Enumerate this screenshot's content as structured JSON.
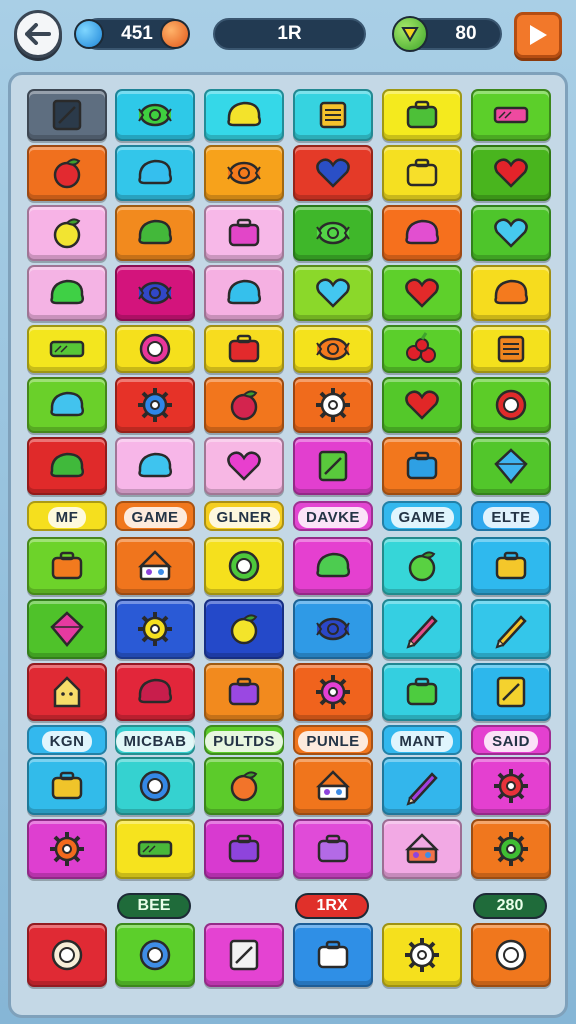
{
  "header": {
    "gems": "451",
    "level": "1R",
    "bonus": "80"
  },
  "board": {
    "rows": [
      [
        {
          "color": "#5e6e80",
          "icon": "frame-icon",
          "glyph": "frame",
          "fg": "#2b3a4a"
        },
        {
          "color": "#2ec9e8",
          "icon": "green-candy-icon",
          "glyph": "candy",
          "fg": "#3fcf3f"
        },
        {
          "color": "#35d8e8",
          "icon": "lemon-icon",
          "glyph": "blob",
          "fg": "#f3e32b"
        },
        {
          "color": "#36d3e0",
          "icon": "notepad-icon",
          "glyph": "note",
          "fg": "#f5c22c"
        },
        {
          "color": "#f4ea1e",
          "icon": "lunchbox-icon",
          "glyph": "box",
          "fg": "#4dc038"
        },
        {
          "color": "#5ccf2a",
          "icon": "pink-bar-icon",
          "glyph": "bar",
          "fg": "#ef4aa0"
        }
      ],
      [
        {
          "color": "#f0701e",
          "icon": "tomato-icon",
          "glyph": "fruit",
          "fg": "#e22a30"
        },
        {
          "color": "#33c6ea",
          "icon": "blue-bun-icon",
          "glyph": "blob",
          "fg": "#35bfee"
        },
        {
          "color": "#f7a21b",
          "icon": "orange-candy-icon",
          "glyph": "candy",
          "fg": "#f57a1c"
        },
        {
          "color": "#e43a28",
          "icon": "blue-heart-icon",
          "glyph": "heart",
          "fg": "#2a4fc6"
        },
        {
          "color": "#f5e021",
          "icon": "yellow-case-icon",
          "glyph": "box",
          "fg": "#f7df2a"
        },
        {
          "color": "#49b51e",
          "icon": "strawberry-icon",
          "glyph": "heart",
          "fg": "#e3232a"
        }
      ],
      [
        {
          "color": "#f7b3e6",
          "icon": "lemon-icon",
          "glyph": "fruit",
          "fg": "#f2e431"
        },
        {
          "color": "#f28a1e",
          "icon": "green-bun-icon",
          "glyph": "blob",
          "fg": "#43b83a"
        },
        {
          "color": "#f7b8e8",
          "icon": "pink-pot-icon",
          "glyph": "box",
          "fg": "#e246c8"
        },
        {
          "color": "#3fb72a",
          "icon": "green-candy-icon",
          "glyph": "candy",
          "fg": "#53d446"
        },
        {
          "color": "#f6701d",
          "icon": "pink-shell-icon",
          "glyph": "blob",
          "fg": "#e24fd0"
        },
        {
          "color": "#4ec52b",
          "icon": "cyan-heart-icon",
          "glyph": "heart",
          "fg": "#46c9ee"
        }
      ],
      [
        {
          "color": "#f4b3e4",
          "icon": "green-bun-icon",
          "glyph": "blob",
          "fg": "#3fd045"
        },
        {
          "color": "#d3147c",
          "icon": "blueberry-icon",
          "glyph": "candy",
          "fg": "#3147c8"
        },
        {
          "color": "#f5b0e2",
          "icon": "cyan-bun-icon",
          "glyph": "blob",
          "fg": "#35c0ec"
        },
        {
          "color": "#8bd82a",
          "icon": "cyan-heart-icon",
          "glyph": "heart",
          "fg": "#43c7f0"
        },
        {
          "color": "#5ed02b",
          "icon": "apple-icon",
          "glyph": "heart",
          "fg": "#e32a2a"
        },
        {
          "color": "#f6dc1e",
          "icon": "orange-bun-icon",
          "glyph": "blob",
          "fg": "#f47a1e"
        }
      ],
      [
        {
          "color": "#f3e61e",
          "icon": "battery-icon",
          "glyph": "bar",
          "fg": "#57c637"
        },
        {
          "color": "#f5e01c",
          "icon": "donut-icon",
          "glyph": "ring",
          "fg": "#e9369a"
        },
        {
          "color": "#f7dc1f",
          "icon": "radio-icon",
          "glyph": "box",
          "fg": "#e22a2c"
        },
        {
          "color": "#f4e21c",
          "icon": "orange-candy-icon",
          "glyph": "candy",
          "fg": "#f47a1e"
        },
        {
          "color": "#5bcf2b",
          "icon": "cherries-icon",
          "glyph": "dots",
          "fg": "#e0202a"
        },
        {
          "color": "#f4e11d",
          "icon": "register-icon",
          "glyph": "note",
          "fg": "#f0851e"
        }
      ],
      [
        {
          "color": "#6ad02a",
          "icon": "fish-icon",
          "glyph": "blob",
          "fg": "#42c3ee"
        },
        {
          "color": "#e63228",
          "icon": "blue-gear-icon",
          "glyph": "gear",
          "fg": "#2f86e8"
        },
        {
          "color": "#f2761d",
          "icon": "cherry-icon",
          "glyph": "fruit",
          "fg": "#d3244e"
        },
        {
          "color": "#f06b1c",
          "icon": "gear-icon",
          "glyph": "gear",
          "fg": "#ffffff"
        },
        {
          "color": "#54c82a",
          "icon": "apple-icon",
          "glyph": "heart",
          "fg": "#e12727"
        },
        {
          "color": "#5ccc28",
          "icon": "ring-icon",
          "glyph": "ring",
          "fg": "#e02b2b"
        }
      ],
      [
        {
          "color": "#e02a2a",
          "icon": "green-bun-icon",
          "glyph": "blob",
          "fg": "#40b93b"
        },
        {
          "color": "#f7b6e8",
          "icon": "cyan-candy-icon",
          "glyph": "blob",
          "fg": "#3ec4ef"
        },
        {
          "color": "#f7b7e4",
          "icon": "pink-heart-icon",
          "glyph": "heart",
          "fg": "#e83fce"
        },
        {
          "color": "#e23fcf",
          "icon": "green-bag-icon",
          "glyph": "frame",
          "fg": "#59c93c"
        },
        {
          "color": "#f2771d",
          "icon": "blue-case-icon",
          "glyph": "box",
          "fg": "#2ea0e4"
        },
        {
          "color": "#52c62b",
          "icon": "diamond-icon",
          "glyph": "diamond",
          "fg": "#3fb4ef"
        }
      ],
      [
        {
          "color": "#6dd32a",
          "icon": "pan-icon",
          "glyph": "box",
          "fg": "#f27a1e"
        },
        {
          "color": "#f0751d",
          "icon": "cake-icon",
          "glyph": "cake",
          "fg": "#ffffff"
        },
        {
          "color": "#f5e01d",
          "icon": "green-ring-icon",
          "glyph": "ring",
          "fg": "#4dc83b"
        },
        {
          "color": "#e540d0",
          "icon": "green-bowl-icon",
          "glyph": "blob",
          "fg": "#4dcc50"
        },
        {
          "color": "#36d6d8",
          "icon": "green-apple-icon",
          "glyph": "fruit",
          "fg": "#59d142"
        },
        {
          "color": "#2fb9ee",
          "icon": "photo-icon",
          "glyph": "box",
          "fg": "#f4c72a"
        }
      ],
      [
        {
          "color": "#4fc22a",
          "icon": "kite-icon",
          "glyph": "diamond",
          "fg": "#e63aa0"
        },
        {
          "color": "#2a5ad6",
          "icon": "sun-icon",
          "glyph": "gear",
          "fg": "#f5e01f"
        },
        {
          "color": "#2449c9",
          "icon": "lemon-icon",
          "glyph": "fruit",
          "fg": "#f3e42a"
        },
        {
          "color": "#2f9ae6",
          "icon": "blue-candy-icon",
          "glyph": "candy",
          "fg": "#2b47c6"
        },
        {
          "color": "#35cfe2",
          "icon": "flower-icon",
          "glyph": "pen",
          "fg": "#e64b8b"
        },
        {
          "color": "#34c6ea",
          "icon": "pencil-icon",
          "glyph": "pen",
          "fg": "#f7c52a"
        }
      ],
      [
        {
          "color": "#e02a34",
          "icon": "house-icon",
          "glyph": "house",
          "fg": "#f7dd6a"
        },
        {
          "color": "#e2263a",
          "icon": "ball-icon",
          "glyph": "blob",
          "fg": "#c81e4c"
        },
        {
          "color": "#f28a1e",
          "icon": "purple-box-icon",
          "glyph": "box",
          "fg": "#9a48e2"
        },
        {
          "color": "#f0631d",
          "icon": "pink-pot-icon",
          "glyph": "gear",
          "fg": "#e43fd4"
        },
        {
          "color": "#34cfe0",
          "icon": "green-bag-icon",
          "glyph": "box",
          "fg": "#4dcc3f"
        },
        {
          "color": "#2db7ec",
          "icon": "phone-icon",
          "glyph": "frame",
          "fg": "#f4d22e"
        }
      ],
      [
        {
          "color": "#32bbea",
          "icon": "radio-icon",
          "glyph": "box",
          "fg": "#f0c42a"
        },
        {
          "color": "#35d2d0",
          "icon": "pancake-icon",
          "glyph": "ring",
          "fg": "#3488e6"
        },
        {
          "color": "#5ccb2b",
          "icon": "orange-fruit-icon",
          "glyph": "fruit",
          "fg": "#f2742a"
        },
        {
          "color": "#f0751c",
          "icon": "cake-icon",
          "glyph": "cake",
          "fg": "#ffffff"
        },
        {
          "color": "#33b6ec",
          "icon": "shrimp-icon",
          "glyph": "pen",
          "fg": "#a23ee0"
        },
        {
          "color": "#e440d0",
          "icon": "berry-icon",
          "glyph": "gear",
          "fg": "#e6323a"
        }
      ],
      [
        {
          "color": "#de3fd0",
          "icon": "sun-icon",
          "glyph": "gear",
          "fg": "#f26a1e"
        },
        {
          "color": "#f6e31e",
          "icon": "leaf-icon",
          "glyph": "bar",
          "fg": "#49b83a"
        },
        {
          "color": "#d83ad0",
          "icon": "purple-box-icon",
          "glyph": "box",
          "fg": "#8e44dc"
        },
        {
          "color": "#e04bd8",
          "icon": "purple-pot-icon",
          "glyph": "box",
          "fg": "#b36ae6"
        },
        {
          "color": "#f2a9e4",
          "icon": "pie-icon",
          "glyph": "cake",
          "fg": "#f2724a"
        },
        {
          "color": "#f0771e",
          "icon": "green-flower-icon",
          "glyph": "gear",
          "fg": "#3fbd33"
        }
      ]
    ],
    "labels_row_a": [
      {
        "text": "MF",
        "color": "#f5df1e"
      },
      {
        "text": "GAME",
        "color": "#f0771d"
      },
      {
        "text": "GLNER",
        "color": "#f5ce1f"
      },
      {
        "text": "DAVKE",
        "color": "#e246d2"
      },
      {
        "text": "GAME",
        "color": "#33b8ee"
      },
      {
        "text": "ELTE",
        "color": "#2fa8ee"
      }
    ],
    "labels_row_b": [
      {
        "text": "KGN",
        "color": "#33b8ee"
      },
      {
        "text": "MICBAB",
        "color": "#36cfcf"
      },
      {
        "text": "PULTDS",
        "color": "#5ccb2b"
      },
      {
        "text": "PUNLE",
        "color": "#f0751c"
      },
      {
        "text": "MANT",
        "color": "#33b8ee"
      },
      {
        "text": "SAID",
        "color": "#e440d0"
      }
    ]
  },
  "dock": {
    "badge_1": "BEE",
    "badge_2": "1RX",
    "badge_3": "280",
    "items": [
      {
        "color": "#e02a34",
        "icon": "q-coin-icon",
        "glyph": "ring",
        "fg": "#f7eed8"
      },
      {
        "color": "#5ccf2b",
        "icon": "compass-icon",
        "glyph": "ring",
        "fg": "#3f8de6"
      },
      {
        "color": "#e443d2",
        "icon": "bag-icon",
        "glyph": "frame",
        "fg": "#f2f2f2"
      },
      {
        "color": "#2f8fe6",
        "icon": "camera-icon",
        "glyph": "box",
        "fg": "#ffffff"
      },
      {
        "color": "#f5e01d",
        "icon": "flower-icon",
        "glyph": "gear",
        "fg": "#ffffff"
      },
      {
        "color": "#f0771d",
        "icon": "cookie-icon",
        "glyph": "ring",
        "fg": "#ffffff"
      }
    ]
  }
}
